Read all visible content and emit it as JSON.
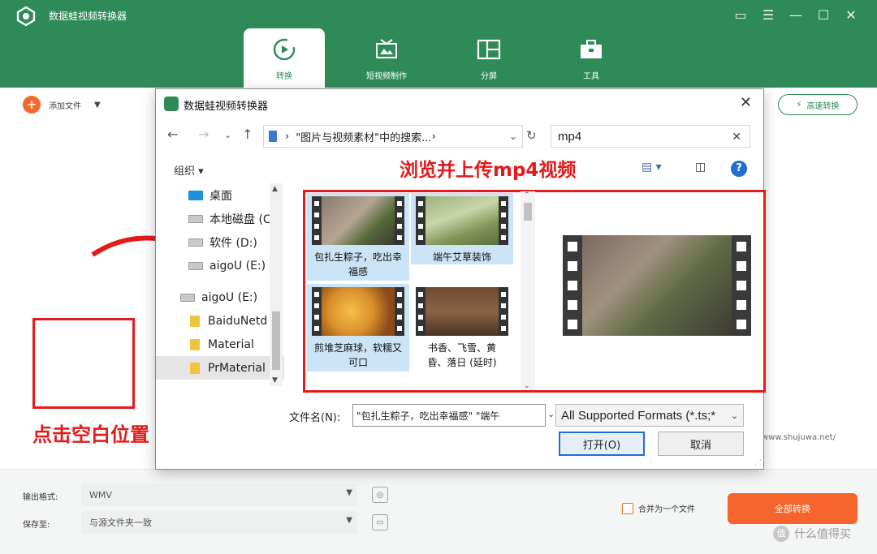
{
  "app": {
    "title": "数据蛙视频转换器"
  },
  "tabs": [
    {
      "label": "转换",
      "icon": "convert-icon"
    },
    {
      "label": "短视频制作",
      "icon": "short-video-icon"
    },
    {
      "label": "分屏",
      "icon": "split-screen-icon"
    },
    {
      "label": "工具",
      "icon": "toolbox-icon"
    }
  ],
  "toolbar": {
    "add_label": "添加文件",
    "speed_label": "高速转换"
  },
  "annotations": {
    "click_hint": "点击空白位置",
    "upload_hint": "浏览并上传mp4视频",
    "watermark_url": "www.shujuwa.net/"
  },
  "bottom": {
    "format_label": "输出格式:",
    "format_value": "WMV",
    "save_label": "保存至:",
    "save_value": "与源文件夹一致",
    "merge_label": "合并为一个文件",
    "convert_all": "全部转换",
    "brand": "什么值得买"
  },
  "dialog": {
    "title": "数据蛙视频转换器",
    "address": "\"图片与视频素材\"中的搜索... ",
    "search_value": "mp4",
    "organize": "组织 ▾",
    "tree": [
      {
        "label": "桌面",
        "icon": "desktop"
      },
      {
        "label": "本地磁盘 (C",
        "icon": "drive"
      },
      {
        "label": "软件 (D:)",
        "icon": "drive"
      },
      {
        "label": "aigoU (E:)",
        "icon": "drive"
      },
      {
        "label": "aigoU (E:)",
        "icon": "drive"
      },
      {
        "label": "BaiduNetd",
        "icon": "folder"
      },
      {
        "label": "Material",
        "icon": "folder"
      },
      {
        "label": "PrMaterial",
        "icon": "folder"
      }
    ],
    "files": [
      {
        "label": "包扎生粽子，吃出幸福感",
        "selected": true
      },
      {
        "label": "端午艾草装饰",
        "selected": true
      },
      {
        "label": "煎堆芝麻球，软糯又可口",
        "selected": true
      },
      {
        "label": "书香、飞雪、黄昏、落日 (延时)",
        "selected": false
      }
    ],
    "filename_label": "文件名(N):",
    "filename_value": "\"包扎生粽子，吃出幸福感\" \"端午",
    "filter_value": "All Supported Formats (*.ts;*",
    "open_label": "打开(O)",
    "cancel_label": "取消"
  }
}
